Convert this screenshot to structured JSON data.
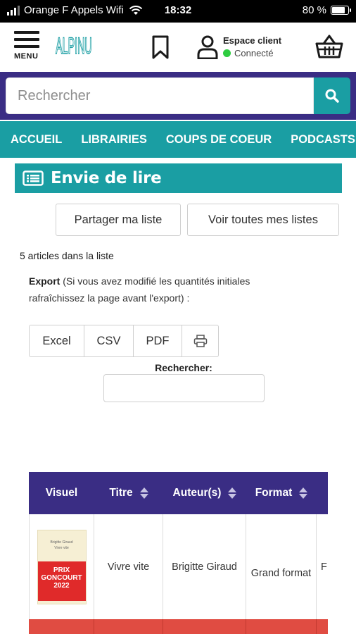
{
  "status_bar": {
    "carrier": "Orange F Appels Wifi",
    "time": "18:32",
    "battery": "80 %",
    "battery_level": 0.8
  },
  "header": {
    "menu_label": "MENU",
    "logo_text": "ALPINU",
    "account_title": "Espace client",
    "account_status": "Connecté"
  },
  "search": {
    "placeholder": "Rechercher"
  },
  "nav": {
    "items": [
      "ACCUEIL",
      "LIBRAIRIES",
      "COUPS DE COEUR",
      "PODCASTS"
    ]
  },
  "page": {
    "title": "Envie de lire",
    "share_button": "Partager ma liste",
    "all_lists_button": "Voir toutes mes listes",
    "item_count": "5 articles dans la liste",
    "export_label": "Export",
    "export_note": " (Si vous avez modifié les quantités initiales rafraîchissez la page avant l'export) :",
    "export_buttons": [
      "Excel",
      "CSV",
      "PDF"
    ],
    "filter_label": "Rechercher:",
    "filter_value": ""
  },
  "table": {
    "columns": [
      "Visuel",
      "Titre",
      "Auteur(s)",
      "Format"
    ],
    "rows": [
      {
        "titre": "Vivre vite",
        "auteur": "Brigitte Giraud",
        "format": "Grand format",
        "extra": "F",
        "cover": {
          "author": "Brigitte Giraud",
          "title": "Vivre vite",
          "band_line1": "PRIX",
          "band_line2": "GONCOURT",
          "band_line3": "2022"
        }
      }
    ]
  },
  "colors": {
    "teal": "#1a9ea3",
    "purple": "#3a2d84",
    "red": "#e04c42",
    "status_green": "#2ecc40"
  }
}
